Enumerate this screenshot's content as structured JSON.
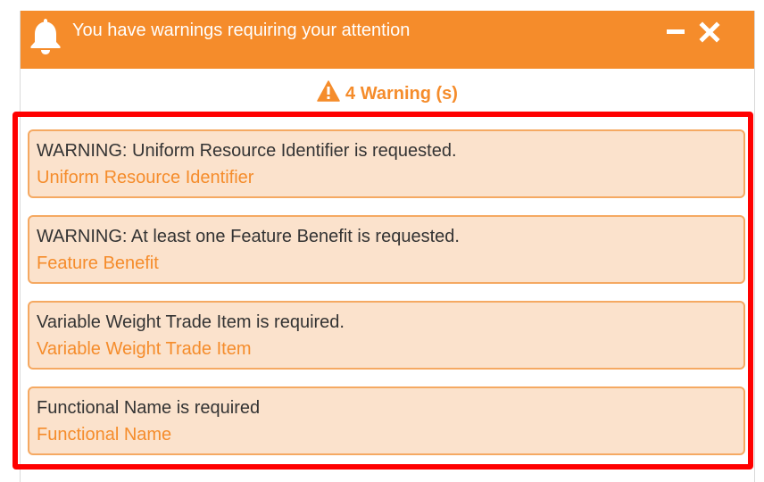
{
  "dialog": {
    "title": "You have warnings requiring your attention",
    "icons": {
      "bell": "bell-icon",
      "minimize": "minimize-icon",
      "close": "close-icon",
      "warning": "warning-triangle-icon"
    }
  },
  "summary": {
    "label": "4 Warning (s)"
  },
  "warnings": [
    {
      "message": "WARNING: Uniform Resource Identifier is requested.",
      "link": "Uniform Resource Identifier"
    },
    {
      "message": "WARNING: At least one Feature Benefit is requested.",
      "link": "Feature Benefit"
    },
    {
      "message": "Variable Weight Trade Item is required.",
      "link": "Variable Weight Trade Item"
    },
    {
      "message": "Functional Name is required",
      "link": "Functional Name"
    }
  ],
  "colors": {
    "accent": "#f58c2b",
    "item_background": "#fbe2cc",
    "item_border": "#f5a962",
    "highlight": "#ff0000",
    "text": "#333333"
  }
}
